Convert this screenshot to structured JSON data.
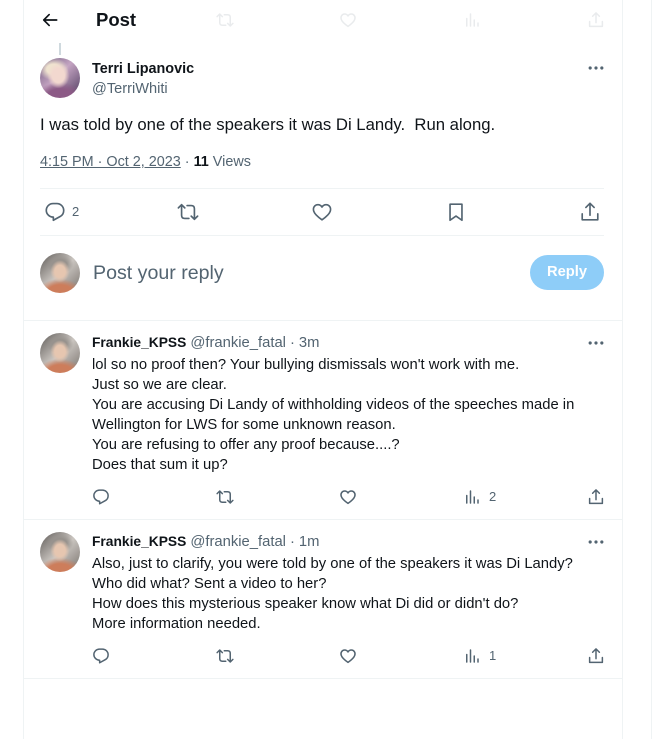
{
  "header": {
    "title": "Post",
    "back_icon": "back-arrow-icon"
  },
  "tweet": {
    "author": {
      "name": "Terri Lipanovic",
      "handle": "@TerriWhiti"
    },
    "more_icon": "more-icon",
    "text": "I was told by one of the speakers it was Di Landy.  Run along.",
    "timestamp": "4:15 PM · Oct 2, 2023",
    "separator": "·",
    "views_count": "11",
    "views_label": "Views",
    "actions": [
      {
        "icon": "reply-icon",
        "count": "2"
      },
      {
        "icon": "retweet-icon"
      },
      {
        "icon": "like-icon"
      },
      {
        "icon": "bookmark-icon"
      },
      {
        "icon": "share-icon"
      }
    ]
  },
  "composer": {
    "placeholder": "Post your reply",
    "button_label": "Reply"
  },
  "replies": [
    {
      "name": "Frankie_KPSS",
      "handle": "@frankie_fatal",
      "separator": "·",
      "time": "3m",
      "lines": [
        "lol so no proof then? Your bullying dismissals won't work with me.",
        "Just so we are clear.",
        "You are accusing Di Landy of withholding videos of the speeches made in",
        "Wellington for LWS for some unknown reason.",
        "You are refusing to offer any proof because....?",
        "Does that sum it up?"
      ],
      "actions": [
        {
          "icon": "reply-icon"
        },
        {
          "icon": "retweet-icon"
        },
        {
          "icon": "like-icon"
        },
        {
          "icon": "views-icon",
          "count": "2"
        },
        {
          "icon": "share-icon"
        }
      ]
    },
    {
      "name": "Frankie_KPSS",
      "handle": "@frankie_fatal",
      "separator": "·",
      "time": "1m",
      "lines": [
        "Also, just to clarify, you were told by one of the speakers it was Di Landy?",
        "Who did what? Sent a video to her?",
        "How does this mysterious speaker know what Di did or didn't do?",
        "More information needed."
      ],
      "actions": [
        {
          "icon": "reply-icon"
        },
        {
          "icon": "retweet-icon"
        },
        {
          "icon": "like-icon"
        },
        {
          "icon": "views-icon",
          "count": "1"
        },
        {
          "icon": "share-icon"
        }
      ]
    }
  ],
  "colors": {
    "text": "#0f1419",
    "secondary": "#536471",
    "divider": "#eff3f4",
    "reply_button": "#8ecdf8",
    "reply_button_text": "#ffffff"
  }
}
